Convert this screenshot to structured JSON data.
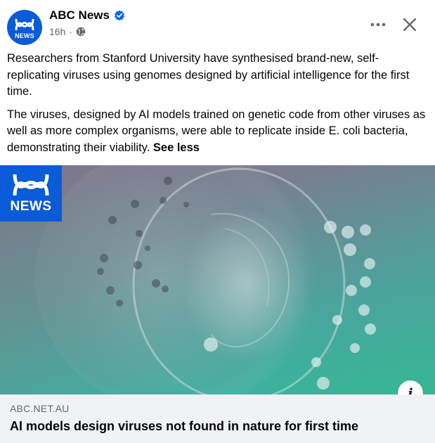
{
  "post": {
    "page_name": "ABC News",
    "time": "16h",
    "separator": "·",
    "avatar_text": "NEWS",
    "paragraph1": "Researchers from Stanford University have synthesised brand-new, self-replicating viruses using genomes designed by artificial intelligence for the first time.",
    "paragraph2": "The viruses, designed by AI models trained on genetic code from other viruses as well as more complex organisms, were able to replicate inside E. coli bacteria, demonstrating their viability.",
    "see_less": "See less"
  },
  "link": {
    "logo_text": "NEWS",
    "domain": "ABC.NET.AU",
    "title": "AI models design viruses not found in nature for first time"
  },
  "icons": {
    "verified": "verified-badge-icon",
    "audience": "globe-icon",
    "more": "more-options-icon",
    "close": "close-icon",
    "info": "info-icon"
  },
  "colors": {
    "brand_blue": "#0a5bd8",
    "verified_blue": "#0866ff",
    "secondary_text": "#65676b",
    "footer_bg": "#f0f2f5"
  }
}
